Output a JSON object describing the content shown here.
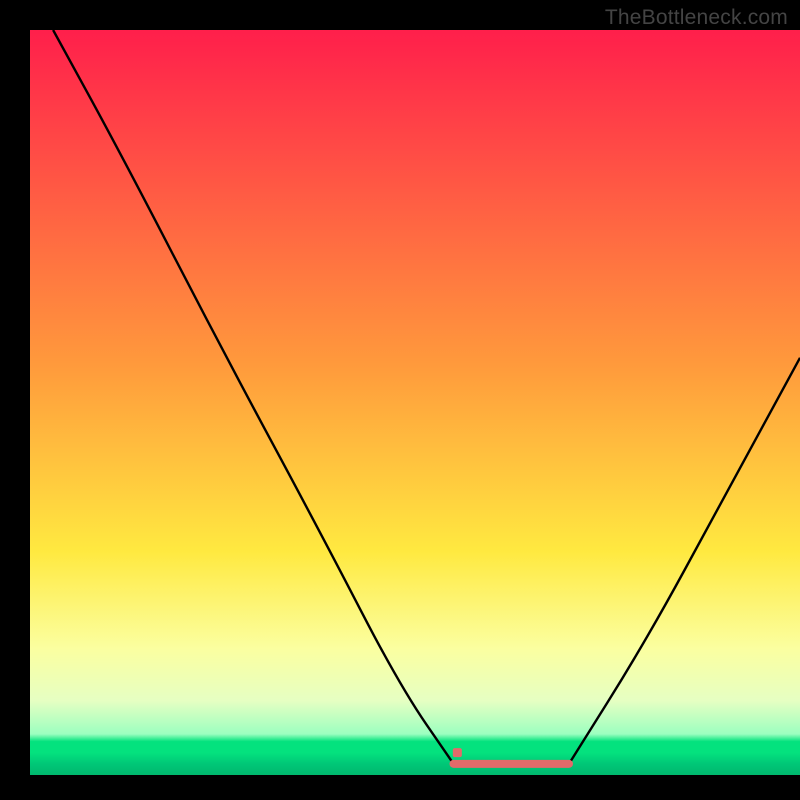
{
  "watermark": "TheBottleneck.com",
  "chart_data": {
    "type": "line",
    "title": "",
    "xlabel": "",
    "ylabel": "",
    "xlim": [
      0,
      100
    ],
    "ylim": [
      0,
      100
    ],
    "grid": false,
    "colors": {
      "curve": "#000000",
      "flat_segment": "#E26A6A",
      "marker": "#E26A6A",
      "gradient_stops": [
        {
          "offset": 0.0,
          "color": "#FF1F4B"
        },
        {
          "offset": 0.45,
          "color": "#FF9A3C"
        },
        {
          "offset": 0.7,
          "color": "#FFE940"
        },
        {
          "offset": 0.83,
          "color": "#FBFFA0"
        },
        {
          "offset": 0.9,
          "color": "#E6FFC2"
        },
        {
          "offset": 0.945,
          "color": "#9CFFC0"
        },
        {
          "offset": 0.955,
          "color": "#04E27E"
        },
        {
          "offset": 0.97,
          "color": "#04E27E"
        },
        {
          "offset": 0.985,
          "color": "#00C777"
        },
        {
          "offset": 1.0,
          "color": "#00B86E"
        }
      ]
    },
    "left_curve": {
      "x": [
        3,
        12,
        25,
        38,
        48,
        55
      ],
      "values": [
        100,
        83,
        57,
        32,
        12,
        1.5
      ]
    },
    "flat_segment": {
      "x_start": 55,
      "x_end": 70,
      "y": 1.5
    },
    "right_curve": {
      "x": [
        70,
        80,
        90,
        100
      ],
      "values": [
        1.5,
        18,
        37,
        56
      ]
    },
    "marker": {
      "x": 55.5,
      "y": 3
    }
  }
}
